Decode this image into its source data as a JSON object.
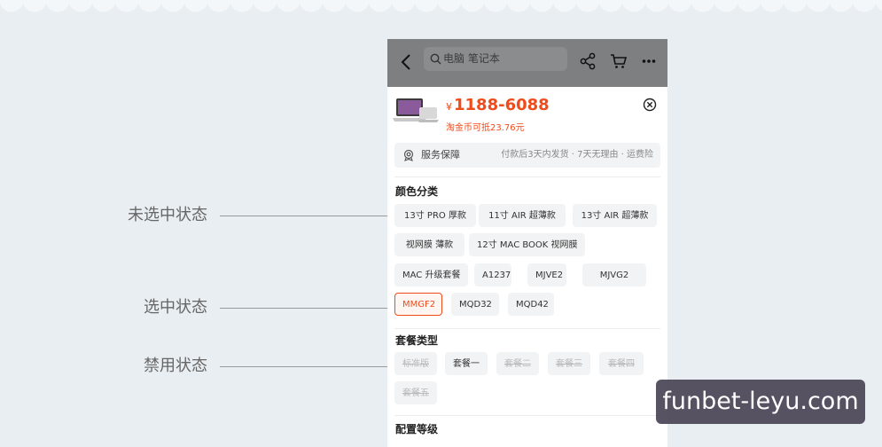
{
  "annotations": {
    "unselected": "未选中状态",
    "selected": "选中状态",
    "disabled": "禁用状态"
  },
  "topbar": {
    "search_text": "电脑 笔记本",
    "icons": [
      "back-icon",
      "search-icon",
      "share-icon",
      "cart-icon",
      "more-icon"
    ]
  },
  "product": {
    "price_symbol": "¥",
    "price_range": "1188-6088",
    "coin_text": "淘金币可抵23.76元"
  },
  "service": {
    "label": "服务保障",
    "detail": "付款后3天内发货 · 7天无理由 · 运费险"
  },
  "sections": {
    "color": {
      "title": "颜色分类",
      "options": [
        {
          "label": "13寸 PRO 厚款",
          "state": "normal"
        },
        {
          "label": "11寸  AIR 超薄款",
          "state": "normal"
        },
        {
          "label": "13寸  AIR 超薄款",
          "state": "normal"
        },
        {
          "label": "视网膜  薄款",
          "state": "normal"
        },
        {
          "label": "12寸 MAC BOOK 视网膜",
          "state": "normal"
        },
        {
          "label": "MAC 升级套餐",
          "state": "normal"
        },
        {
          "label": "A1237",
          "state": "normal"
        },
        {
          "label": "MJVE2",
          "state": "normal"
        },
        {
          "label": "MJVG2",
          "state": "normal"
        },
        {
          "label": "MMGF2",
          "state": "selected"
        },
        {
          "label": "MQD32",
          "state": "normal"
        },
        {
          "label": "MQD42",
          "state": "normal"
        }
      ]
    },
    "package": {
      "title": "套餐类型",
      "options": [
        {
          "label": "标准版",
          "state": "disabled"
        },
        {
          "label": "套餐一",
          "state": "normal"
        },
        {
          "label": "套餐二",
          "state": "disabled"
        },
        {
          "label": "套餐三",
          "state": "disabled"
        },
        {
          "label": "套餐四",
          "state": "disabled"
        },
        {
          "label": "套餐五",
          "state": "disabled"
        }
      ]
    },
    "config": {
      "title": "配置等级"
    }
  },
  "watermark": "funbet-leyu.com",
  "colors": {
    "accent": "#f04b1b",
    "topbar": "#7e7f80",
    "chip_bg": "#f2f3f4",
    "background": "#e9eef2"
  }
}
